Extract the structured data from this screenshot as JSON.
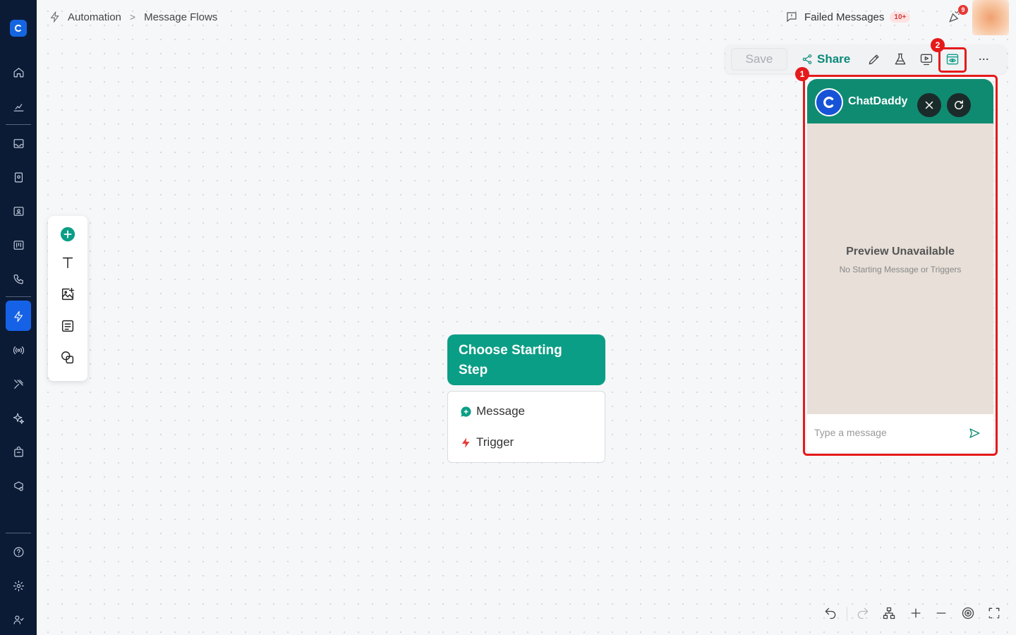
{
  "breadcrumb": {
    "items": [
      "Automation",
      "Message Flows"
    ],
    "separator": ">"
  },
  "header": {
    "failed_messages_label": "Failed Messages",
    "failed_messages_badge": "10+",
    "notification_count": "9"
  },
  "toolbar": {
    "save_label": "Save",
    "share_label": "Share"
  },
  "annotations": {
    "marker_1": "1",
    "marker_2": "2"
  },
  "start_node": {
    "title": "Choose Starting Step",
    "options": [
      "Message",
      "Trigger"
    ]
  },
  "preview": {
    "brand": "ChatDaddy",
    "title": "Preview Unavailable",
    "subtitle": "No Starting Message or Triggers",
    "input_placeholder": "Type a message"
  },
  "colors": {
    "accent": "#0b9e86",
    "sidebar": "#0c1b35",
    "highlight": "#e51a1a",
    "active_nav": "#1662e6"
  },
  "icons": {
    "sidebar": [
      "home-icon",
      "analytics-icon",
      "inbox-icon",
      "contacts-icon",
      "id-card-icon",
      "board-icon",
      "phone-icon",
      "automation-icon",
      "broadcast-icon",
      "tools-icon",
      "ai-sparkle-icon",
      "store-icon",
      "integrations-icon",
      "help-icon",
      "settings-icon",
      "team-icon"
    ],
    "palette": [
      "add-node-icon",
      "text-icon",
      "image-icon",
      "note-icon",
      "shapes-icon"
    ]
  }
}
